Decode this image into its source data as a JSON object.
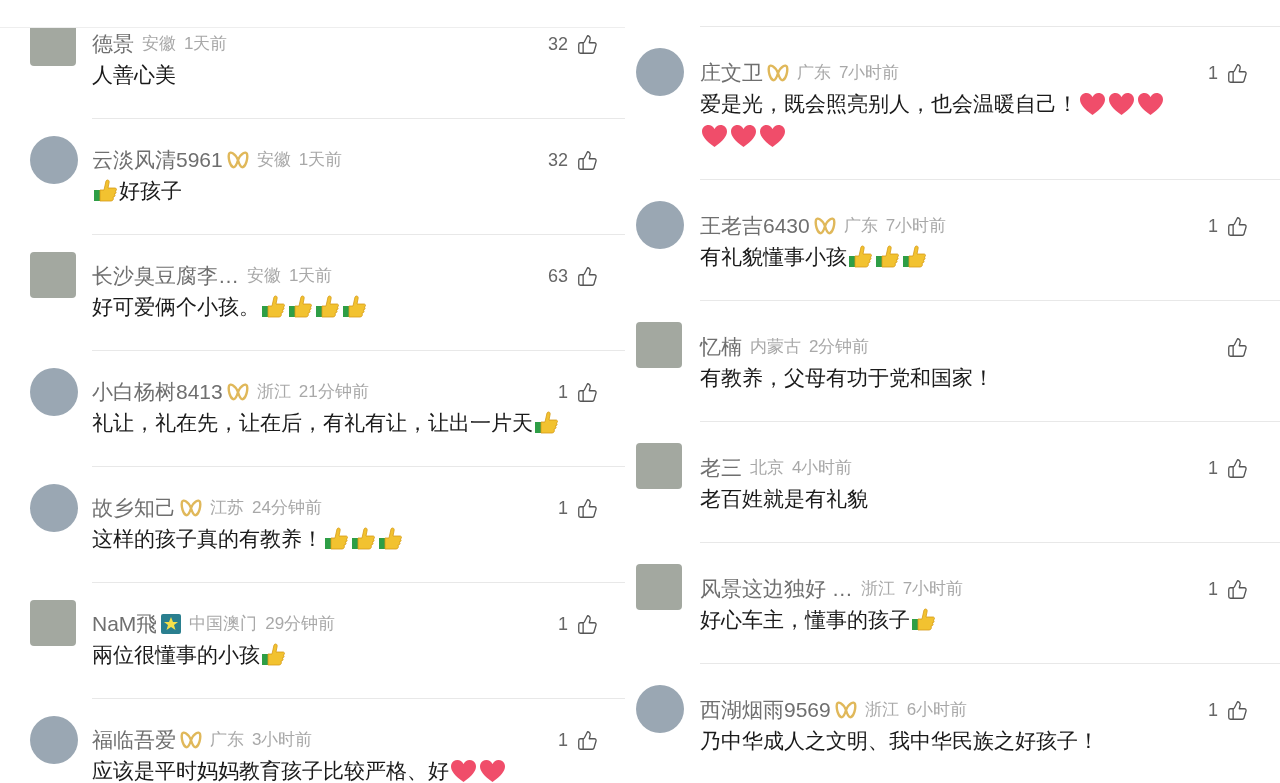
{
  "left_comments": [
    {
      "user": "德景",
      "location": "安徽",
      "time": "1天前",
      "likes": "32",
      "avatar_round": false,
      "parts": [
        {
          "kind": "text",
          "text": "人善心美"
        }
      ]
    },
    {
      "user": "云淡风清5961",
      "badge": {
        "kind": "ribbon"
      },
      "location": "安徽",
      "time": "1天前",
      "likes": "32",
      "avatar_round": true,
      "parts": [
        {
          "kind": "thumb"
        },
        {
          "kind": "text",
          "text": "好孩子"
        }
      ]
    },
    {
      "user": "长沙臭豆腐李…",
      "location": "安徽",
      "time": "1天前",
      "likes": "63",
      "avatar_round": false,
      "parts": [
        {
          "kind": "text",
          "text": "好可爱俩个小孩。"
        },
        {
          "kind": "thumb"
        },
        {
          "kind": "thumb"
        },
        {
          "kind": "thumb"
        },
        {
          "kind": "thumb"
        }
      ]
    },
    {
      "user": "小白杨树8413",
      "badge": {
        "kind": "ribbon"
      },
      "location": "浙江",
      "time": "21分钟前",
      "likes": "1",
      "avatar_round": true,
      "parts": [
        {
          "kind": "text",
          "text": "礼让，礼在先，让在后，有礼有让，让出一片天"
        },
        {
          "kind": "thumb"
        }
      ]
    },
    {
      "user": "故乡知己",
      "badge": {
        "kind": "ribbon"
      },
      "location": "江苏",
      "time": "24分钟前",
      "likes": "1",
      "avatar_round": true,
      "parts": [
        {
          "kind": "text",
          "text": "这样的孩子真的有教养！"
        },
        {
          "kind": "thumb"
        },
        {
          "kind": "thumb"
        },
        {
          "kind": "thumb"
        }
      ]
    },
    {
      "user": "NaM飛",
      "badge": {
        "kind": "star"
      },
      "location": "中国澳门",
      "time": "29分钟前",
      "likes": "1",
      "avatar_round": false,
      "parts": [
        {
          "kind": "text",
          "text": "兩位很懂事的小孩"
        },
        {
          "kind": "thumb"
        }
      ]
    },
    {
      "user": "福临吾爱",
      "badge": {
        "kind": "ribbon"
      },
      "location": "广东",
      "time": "3小时前",
      "likes": "1",
      "avatar_round": true,
      "parts": [
        {
          "kind": "text",
          "text": "应该是平时妈妈教育孩子比较严格、好"
        },
        {
          "kind": "heart"
        },
        {
          "kind": "heart"
        }
      ]
    }
  ],
  "right_comments": [
    {
      "user": "庄文卫",
      "badge": {
        "kind": "ribbon"
      },
      "location": "广东",
      "time": "7小时前",
      "likes": "1",
      "avatar_round": true,
      "parts": [
        {
          "kind": "text",
          "text": "爱是光，既会照亮别人，也会温暖自己！"
        },
        {
          "kind": "heart"
        },
        {
          "kind": "heart"
        },
        {
          "kind": "heart"
        },
        {
          "kind": "heart"
        },
        {
          "kind": "heart"
        },
        {
          "kind": "heart"
        }
      ]
    },
    {
      "user": "王老吉6430",
      "badge": {
        "kind": "ribbon"
      },
      "location": "广东",
      "time": "7小时前",
      "likes": "1",
      "avatar_round": true,
      "parts": [
        {
          "kind": "text",
          "text": "有礼貌懂事小孩"
        },
        {
          "kind": "thumb"
        },
        {
          "kind": "thumb"
        },
        {
          "kind": "thumb"
        }
      ]
    },
    {
      "user": "忆楠",
      "location": "内蒙古",
      "time": "2分钟前",
      "avatar_round": false,
      "parts": [
        {
          "kind": "text",
          "text": "有教养，父母有功于党和国家！"
        }
      ]
    },
    {
      "user": "老三",
      "location": "北京",
      "time": "4小时前",
      "likes": "1",
      "avatar_round": false,
      "parts": [
        {
          "kind": "text",
          "text": "老百姓就是有礼貌"
        }
      ]
    },
    {
      "user": "风景这边独好 …",
      "location": "浙江",
      "time": "7小时前",
      "likes": "1",
      "avatar_round": false,
      "parts": [
        {
          "kind": "text",
          "text": "好心车主，懂事的孩子"
        },
        {
          "kind": "thumb"
        }
      ]
    },
    {
      "user": "西湖烟雨9569",
      "badge": {
        "kind": "ribbon"
      },
      "location": "浙江",
      "time": "6小时前",
      "likes": "1",
      "avatar_round": true,
      "parts": [
        {
          "kind": "text",
          "text": "乃中华成人之文明、我中华民族之好孩子！"
        }
      ]
    }
  ]
}
